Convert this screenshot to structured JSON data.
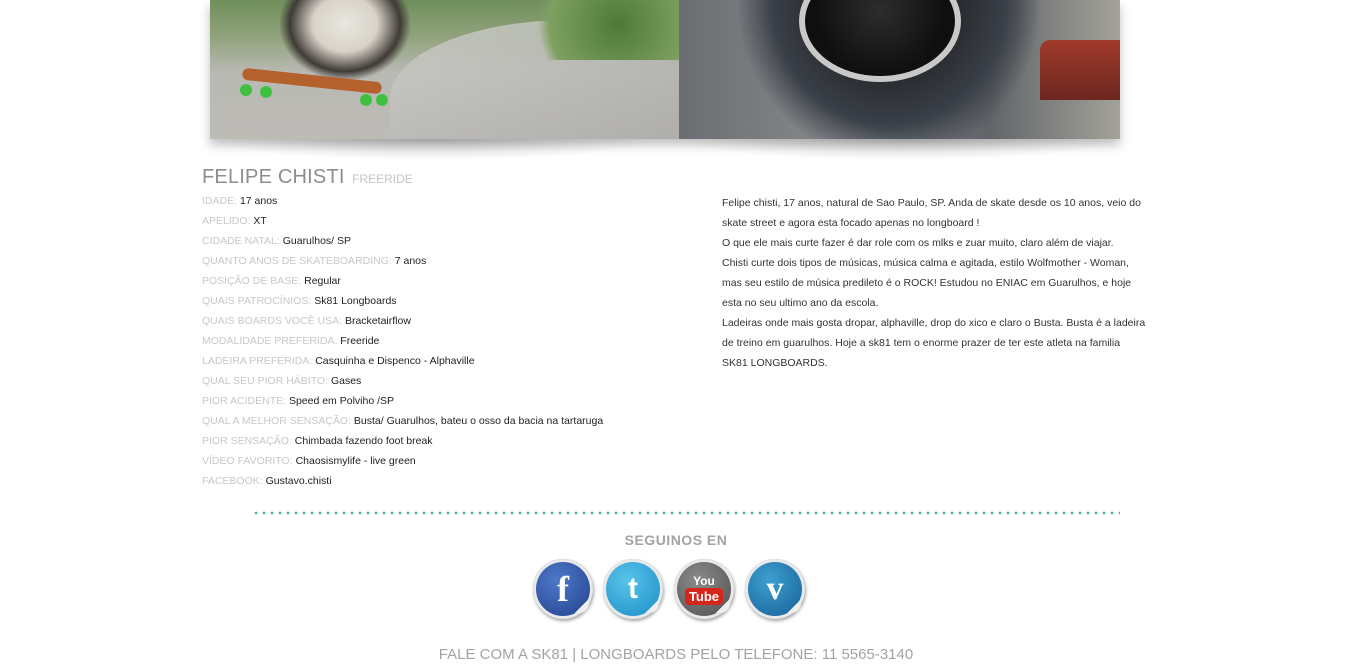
{
  "athlete": {
    "name": "FELIPE CHISTI",
    "discipline": "FREERIDE",
    "stats": [
      {
        "label": "IDADE:",
        "value": "17 anos"
      },
      {
        "label": "APELIDO:",
        "value": "XT"
      },
      {
        "label": "CIDADE NATAL:",
        "value": "Guarulhos/ SP"
      },
      {
        "label": "QUANTO ANOS DE SKATEBOARDING:",
        "value": "7 anos"
      },
      {
        "label": "POSIÇÃO DE BASE:",
        "value": "Regular"
      },
      {
        "label": "QUAIS PATROCÍNIOS:",
        "value": "Sk81 Longboards"
      },
      {
        "label": "QUAIS BOARDS VOCÊ USA:",
        "value": "Bracketairflow"
      },
      {
        "label": "MODALIDADE PREFERIDA:",
        "value": "Freeride"
      },
      {
        "label": "LADEIRA PREFERIDA:",
        "value": "Casquinha e Dispenco - Alphaville"
      },
      {
        "label": "QUAL SEU PIOR HÁBITO:",
        "value": "Gases"
      },
      {
        "label": "PIOR ACIDENTE:",
        "value": "Speed em Polviho /SP"
      },
      {
        "label": "QUAL A MELHOR SENSAÇÃO:",
        "value": "Busta/ Guarulhos, bateu o osso da bacia na tartaruga"
      },
      {
        "label": "PIOR SENSAÇÃO:",
        "value": "Chimbada fazendo foot break"
      },
      {
        "label": "VÍDEO FAVORITO:",
        "value": "Chaosismylife - live green"
      },
      {
        "label": "FACEBOOK:",
        "value": "Gustavo.chisti"
      }
    ],
    "bio": [
      "Felipe chisti, 17 anos, natural de Sao Paulo, SP. Anda de skate desde os 10 anos, veio do skate street e agora esta focado apenas no longboard !",
      "O que ele mais curte fazer é dar role com os mlks e zuar muito, claro além de viajar.",
      "Chisti curte dois tipos de músicas, música calma e agitada, estilo Wolfmother - Woman, mas seu estilo de música predileto é o ROCK! Estudou no ENIAC em Guarulhos, e hoje esta no seu ultimo ano da escola.",
      "Ladeiras onde mais gosta dropar, alphaville, drop do xico e claro o Busta. Busta é a ladeira de treino em guarulhos. Hoje a sk81 tem o enorme prazer de ter este atleta na familia SK81 LONGBOARDS."
    ]
  },
  "social": {
    "title": "SEGUINOS EN",
    "icons": {
      "facebook": "f",
      "twitter": "t",
      "youtube_you": "You",
      "youtube_tube": "Tube",
      "vimeo": "v"
    },
    "colors": {
      "divider_dots": "#37b58f"
    }
  },
  "footer": {
    "text": "FALE COM A SK81 | LONGBOARDS PELO TELEFONE: 11 5565-3140"
  }
}
